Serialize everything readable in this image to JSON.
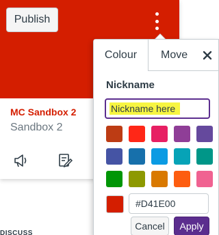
{
  "card": {
    "hero_color": "#D41E00",
    "publish_label": "Publish",
    "title": "MC Sandbox 2",
    "subtitle": "Sandbox 2",
    "icons": [
      "announcements-icon",
      "assignments-icon"
    ],
    "below_text": "DISCUSS"
  },
  "popover": {
    "tabs": [
      {
        "label": "Colour",
        "active": true
      },
      {
        "label": "Move",
        "active": false
      }
    ],
    "close_icon": "close-icon",
    "nickname_label": "Nickname",
    "nickname_placeholder": "Nickname here",
    "swatches": [
      "#BD3C14",
      "#FF2717",
      "#E71F63",
      "#8F3E97",
      "#65499D",
      "#4554A4",
      "#1770AB",
      "#0B9BE3",
      "#06A3B7",
      "#009688",
      "#009606",
      "#8D9900",
      "#D97900",
      "#FD5D10",
      "#F06291"
    ],
    "current_color": "#D41E00",
    "hex_value": "#D41E00",
    "cancel_label": "Cancel",
    "apply_label": "Apply"
  }
}
